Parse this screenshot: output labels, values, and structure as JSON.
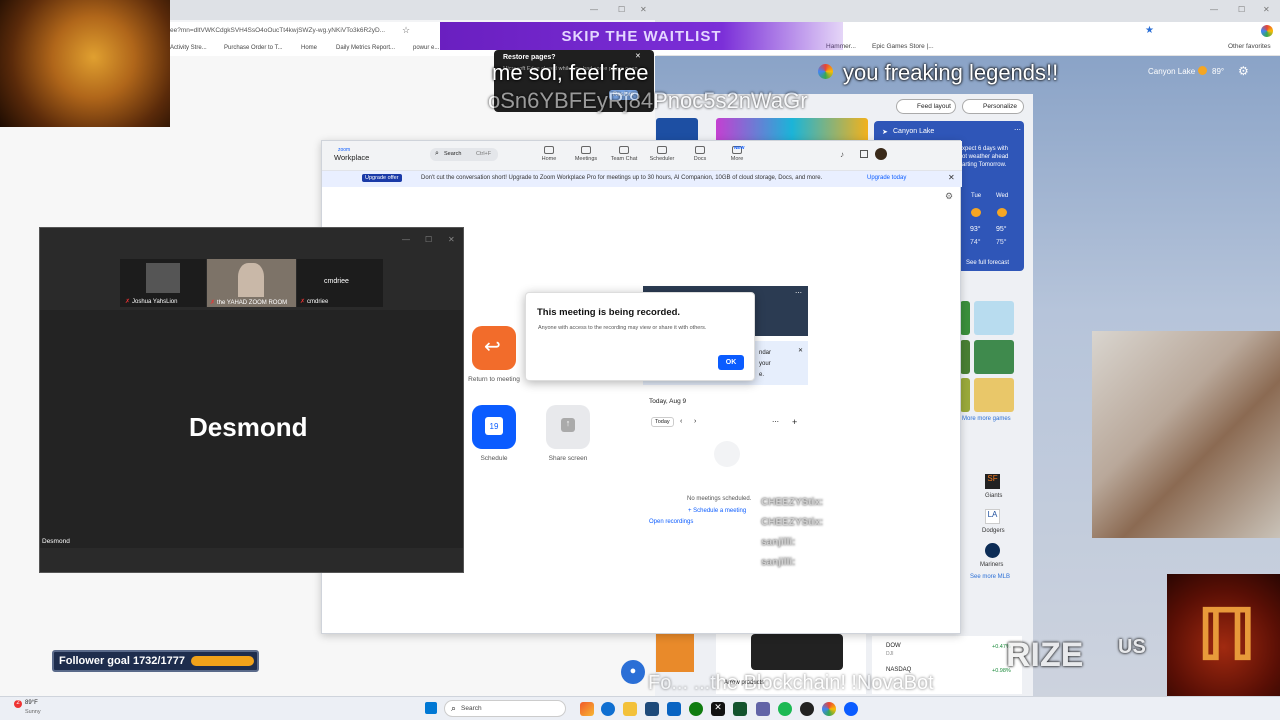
{
  "browser_right": {
    "bookmarks": [
      "Hammer...",
      "Epic Games Store |...",
      "Other favorites"
    ],
    "weather_location": "Canyon Lake",
    "weather_temp": "89°",
    "feed_layout": "Feed layout",
    "personalize": "Personalize",
    "weather_card": {
      "location": "Canyon Lake",
      "text1": "xpect 6 days with",
      "text2": "ot weather ahead",
      "text3": "arting Tomorrow.",
      "days": [
        "Tue",
        "Wed"
      ],
      "highs": [
        "93°",
        "95°"
      ],
      "lows": [
        "74°",
        "75°"
      ],
      "forecast_link": "See full forecast"
    },
    "more_games": "More more games",
    "teams": [
      "Giants",
      "Dodgers",
      "Mariners"
    ],
    "see_more_mlb": "See more MLB",
    "stocks": [
      {
        "name": "DOW",
        "sub": "DJI",
        "change": "+0.47%"
      },
      {
        "name": "NASDAQ",
        "sub": "",
        "change": "+0.98%"
      }
    ],
    "arrow_text": "Arrow products"
  },
  "browser_left": {
    "url": "ee?mn=dltVWKCdgkSVH4SsO4oOucTt4kwjSWZy-wg.yNKiVTo3k6R2yD...",
    "bookmarks": [
      "Activity Stre...",
      "Purchase Order to T...",
      "Home",
      "Daily Metrics Report...",
      "powur e..."
    ]
  },
  "skip_banner": "SKIP THE WAITLIST",
  "restore_popup": {
    "title": "Restore pages?",
    "text": "Microsoft Edge closed while you had some pages open.",
    "button": "Restore"
  },
  "overlay": {
    "line1": "me sol, feel free",
    "line2": "oSn6YBFEyRj84Pnoc5s2nWaGr",
    "line3": "you freaking legends!!",
    "line4": "RIZE",
    "line5": "US",
    "line6": "Fo... ...the Blockchain! !NovaBot",
    "chat": [
      "CHEEZYStix:",
      "CHEEZYStix:",
      "sanjilli:",
      "sanjilli:"
    ]
  },
  "zoom": {
    "brand_top": "zoom",
    "brand_bottom": "Workplace",
    "search": "Search",
    "shortcut": "Ctrl+F",
    "nav": [
      "Home",
      "Meetings",
      "Team Chat",
      "Scheduler",
      "Docs",
      "More"
    ],
    "new_badge": "NEW",
    "upgrade_badge": "Upgrade offer",
    "upgrade_text": "Don't cut the conversation short! Upgrade to Zoom Workplace Pro for meetings up to 30 hours, AI Companion, 10GB of cloud storage, Docs, and more.",
    "upgrade_link": "Upgrade today",
    "return_label": "Return to meeting",
    "schedule_label": "Schedule",
    "schedule_day": "19",
    "share_label": "Share screen",
    "clock_partial": "M",
    "cal_text1": "ndar",
    "cal_text2": "your",
    "cal_text3": "e.",
    "date_label": "Today, Aug 9",
    "today_btn": "Today",
    "no_meetings": "No meetings scheduled.",
    "schedule_meeting": "+ Schedule a meeting",
    "open_recordings": "Open recordings"
  },
  "recording_dialog": {
    "title": "This meeting is being recorded.",
    "body": "Anyone with access to the recording may view or share it with others.",
    "ok": "OK"
  },
  "meeting": {
    "participants": [
      {
        "name": "Joshua YahsLion"
      },
      {
        "name": "the YAHAD ZOOM ROOM"
      },
      {
        "name": "cmdriee",
        "center": "cmdriee"
      }
    ],
    "speaker": "Desmond",
    "speaker_label": "Desmond"
  },
  "follower_goal": "Follower goal 1732/1777",
  "follower_progress": 0.5,
  "taskbar": {
    "weather_temp": "89°F",
    "weather_desc": "Sunny",
    "search": "Search",
    "notification_count": "2"
  }
}
